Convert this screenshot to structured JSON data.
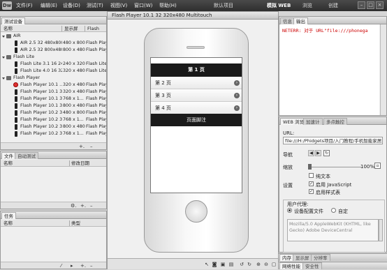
{
  "menubar": {
    "logo": "Dw",
    "items": [
      "文件(F)",
      "编辑(E)",
      "设备(D)",
      "测试(T)",
      "视图(V)",
      "窗口(W)",
      "帮助(H)"
    ],
    "project": "默认项目",
    "workspaces": [
      "模拟 WEB",
      "浏览",
      "创建"
    ]
  },
  "devices_panel": {
    "tab": "测试设备",
    "columns": [
      "名称",
      "显示屏",
      "Flash"
    ],
    "groups": [
      {
        "name": "AIR",
        "devices": [
          {
            "name": "AIR 2.5 32 480x800...",
            "display": "480 x 800",
            "flash": "Flash Playe"
          },
          {
            "name": "AIR 2.5 32 800x480...",
            "display": "800 x 480",
            "flash": "Flash Playe"
          }
        ]
      },
      {
        "name": "Flash Lite",
        "devices": [
          {
            "name": "Flash Lite 3.1 16 24...",
            "display": "240 x 320",
            "flash": "Flash Lite"
          },
          {
            "name": "Flash Lite 4.0 16 32...",
            "display": "320 x 480",
            "flash": "Flash Lite"
          }
        ]
      },
      {
        "name": "Flash Player",
        "devices": [
          {
            "name": "Flash Player 10.1 ...",
            "display": "320 x 480",
            "flash": "Flash Playe"
          },
          {
            "name": "Flash Player 10.1 3...",
            "display": "320 x 480",
            "flash": "Flash Playe"
          },
          {
            "name": "Flash Player 10.1 3...",
            "display": "768 x 1...",
            "flash": "Flash Playe"
          },
          {
            "name": "Flash Player 10.1 3...",
            "display": "800 x 480",
            "flash": "Flash Playe"
          },
          {
            "name": "Flash Player 10.2 3...",
            "display": "480 x 800",
            "flash": "Flash Playe"
          },
          {
            "name": "Flash Player 10.2 3...",
            "display": "768 x 1...",
            "flash": "Flash Playe"
          },
          {
            "name": "Flash Player 10.2 3...",
            "display": "800 x 480",
            "flash": "Flash Playe"
          },
          {
            "name": "Flash Player 10.2 3...",
            "display": "768 x 1...",
            "flash": "Flash Playe"
          }
        ]
      }
    ]
  },
  "files_panel": {
    "tabs": [
      "文件",
      "自动测试"
    ],
    "columns": [
      "名称",
      "修改日期"
    ]
  },
  "tasks_panel": {
    "tab": "任务",
    "columns": [
      "名称",
      "类型"
    ]
  },
  "preview": {
    "title": "Flash Player 10.1 32 320x480 Multitouch",
    "screen": {
      "header": "第 1 页",
      "items": [
        "第 2 页",
        "第 3 页",
        "第 4 页"
      ],
      "footer": "页面脚注"
    }
  },
  "output_panel": {
    "tabs": [
      "信息",
      "输出"
    ],
    "text": "NETERR: 对于 URL\"file:///phonega"
  },
  "web_panel": {
    "tabs": [
      "WEB 浏览",
      "加速计",
      "多点触控"
    ],
    "url_label": "URL:",
    "url_value": "file:///H:/Phidgets项目/入门教程/手机智能家居",
    "nav_label": "导航",
    "zoom_label": "缩放",
    "zoom_value": "100%",
    "settings_label": "设置",
    "opt_plain": "纯文本",
    "opt_js": "启用 JavaScript",
    "opt_css": "启用样式表",
    "ua_label": "用户代理:",
    "ua_opt1": "设备配置文件",
    "ua_opt2": "自定",
    "ua_text": "Mozilla/5.0 AppleWebKit (KHTML, like Gecko) Adobe DeviceCentral"
  },
  "bottom_right_tabs": [
    "内存",
    "显示屏",
    "分辨率"
  ],
  "bottom_right_tabs2": [
    "网络性能",
    "安全性"
  ]
}
